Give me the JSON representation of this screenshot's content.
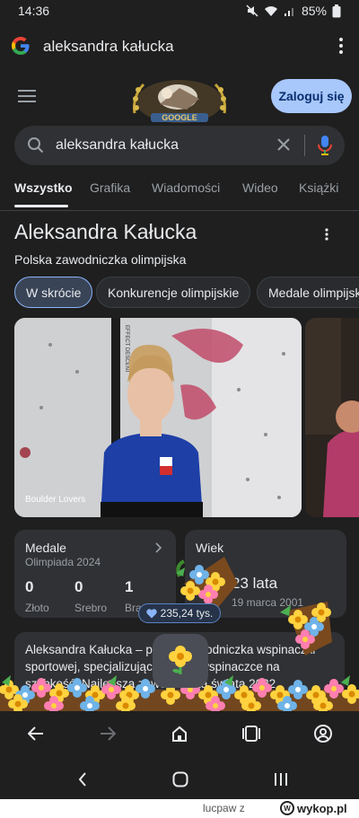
{
  "status_bar": {
    "time": "14:36",
    "battery": "85%"
  },
  "url_bar": {
    "query": "aleksandra kałucka"
  },
  "google_header": {
    "login_label": "Zaloguj się",
    "doodle_text": "GOOGLE"
  },
  "search": {
    "value": "aleksandra kałucka"
  },
  "tabs": [
    {
      "label": "Wszystko",
      "active": true
    },
    {
      "label": "Grafika",
      "active": false
    },
    {
      "label": "Wiadomości",
      "active": false
    },
    {
      "label": "Wideo",
      "active": false
    },
    {
      "label": "Książki",
      "active": false
    }
  ],
  "knowledge_panel": {
    "title": "Aleksandra Kałucka",
    "subtitle": "Polska zawodniczka olimpijska",
    "chips": [
      {
        "label": "W skrócie",
        "active": true
      },
      {
        "label": "Konkurencje olimpijskie",
        "active": false
      },
      {
        "label": "Medale olimpijskie",
        "active": false
      }
    ],
    "photo_caption": "Boulder Lovers",
    "medals_card": {
      "title": "Medale",
      "subtitle": "Olimpiada 2024",
      "medals": [
        {
          "count": "0",
          "label": "Złoto"
        },
        {
          "count": "0",
          "label": "Srebro"
        },
        {
          "count": "1",
          "label": "Brąz"
        }
      ]
    },
    "age_card": {
      "title": "Wiek",
      "value": "23 lata",
      "date": "19 marca 2001"
    },
    "description": "Aleksandra Kałucka – polska zawodniczka wspinaczki sportowej, specjalizująca się we wspinaczce na szybkość. Najlepsza zawodniczka świata 2022."
  },
  "overlay": {
    "likes": "235,24 tys."
  },
  "colors": {
    "background": "#1f1f1f",
    "surface": "#303134",
    "accent": "#a8c7fa",
    "chip_active": "#394457"
  },
  "watermark": {
    "user": "lucpaw",
    "separator": "z",
    "site": "wykop.pl"
  }
}
